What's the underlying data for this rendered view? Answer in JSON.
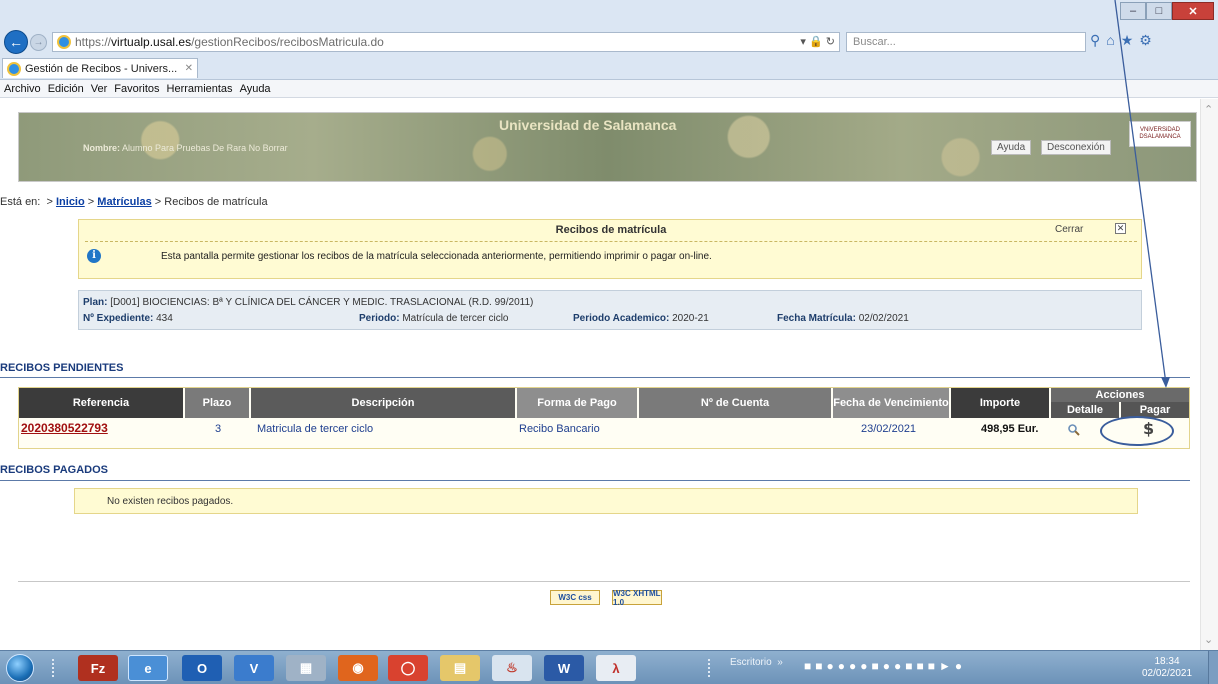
{
  "browser": {
    "url_prefix": "https://",
    "url_domain": "virtualp.usal.es",
    "url_path": "/gestionRecibos/recibosMatricula.do",
    "search_placeholder": "Buscar...",
    "tab_title": "Gestión de Recibos - Univers...",
    "menu": [
      "Archivo",
      "Edición",
      "Ver",
      "Favoritos",
      "Herramientas",
      "Ayuda"
    ]
  },
  "banner": {
    "title": "Universidad de Salamanca",
    "user_label": "Nombre:",
    "user_name": "Alumno Para Pruebas De Rara No Borrar",
    "help": "Ayuda",
    "logout": "Desconexión",
    "logo_text": "VNiVERSiDAD DSALAMANCA"
  },
  "breadcrumb": {
    "prefix": "Está en:",
    "sep": ">",
    "items": [
      "Inicio",
      "Matrículas",
      "Recibos de matrícula"
    ]
  },
  "info": {
    "title": "Recibos de matrícula",
    "close": "Cerrar",
    "close_x": "✕",
    "icon": "i",
    "text": "Esta pantalla permite gestionar los recibos de la matrícula seleccionada anteriormente, permitiendo imprimir o pagar on-line."
  },
  "plan": {
    "plan_label": "Plan:",
    "plan_value": "[D001]  BIOCIENCIAS: Bª Y CLÍNICA DEL CÁNCER Y MEDIC. TRASLACIONAL (R.D. 99/2011)",
    "exp_label": "Nº Expediente:",
    "exp_value": "434",
    "periodo_label": "Periodo:",
    "periodo_value": "Matrícula de tercer ciclo",
    "acad_label": "Periodo Academico:",
    "acad_value": "2020-21",
    "fecha_label": "Fecha Matrícula:",
    "fecha_value": "02/02/2021"
  },
  "pendientes": {
    "title": "RECIBOS PENDIENTES",
    "headers": {
      "referencia": "Referencia",
      "plazo": "Plazo",
      "descripcion": "Descripción",
      "forma_pago": "Forma de Pago",
      "cuenta": "Nº de Cuenta",
      "vencimiento": "Fecha de Vencimiento",
      "importe": "Importe",
      "acciones": "Acciones",
      "detalle": "Detalle",
      "pagar": "Pagar"
    },
    "row": {
      "referencia": "2020380522793",
      "plazo": "3",
      "descripcion": "Matricula de tercer ciclo",
      "forma_pago": "Recibo Bancario",
      "cuenta": "",
      "vencimiento": "23/02/2021",
      "importe": "498,95 Eur.",
      "pay_symbol": "$"
    }
  },
  "pagados": {
    "title": "RECIBOS PAGADOS",
    "empty": "No existen recibos pagados."
  },
  "footer": {
    "badge_css": "W3C css",
    "badge_xhtml": "W3C XHTML 1.0"
  },
  "taskbar": {
    "escritorio": "Escritorio",
    "time": "18:34",
    "date": "02/02/2021"
  }
}
